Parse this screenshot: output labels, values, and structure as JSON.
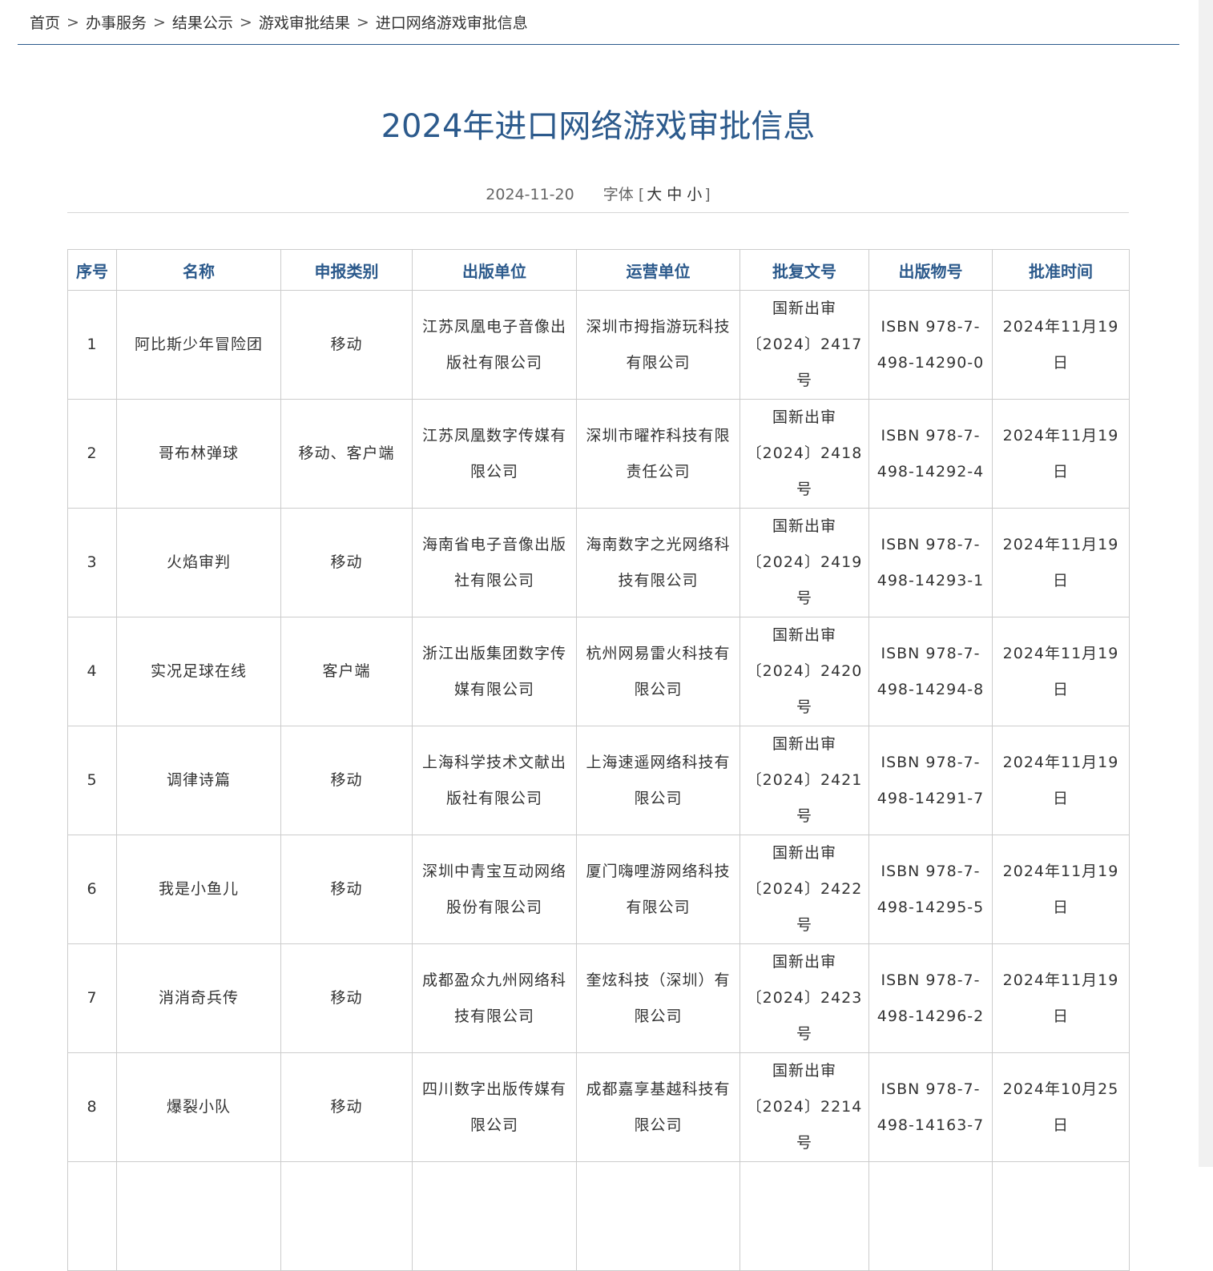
{
  "breadcrumb": {
    "separator": ">",
    "items": [
      "首页",
      "办事服务",
      "结果公示",
      "游戏审批结果",
      "进口网络游戏审批信息"
    ]
  },
  "article": {
    "title": "2024年进口网络游戏审批信息",
    "date": "2024-11-20",
    "font_size_label": "字体",
    "font_size_open": "[",
    "font_size_options": [
      "大",
      "中",
      "小"
    ],
    "font_size_close": "]"
  },
  "table": {
    "headers": [
      "序号",
      "名称",
      "申报类别",
      "出版单位",
      "运营单位",
      "批复文号",
      "出版物号",
      "批准时间"
    ],
    "rows": [
      [
        "1",
        "阿比斯少年冒险团",
        "移动",
        "江苏凤凰电子音像出版社有限公司",
        "深圳市拇指游玩科技有限公司",
        "国新出审〔2024〕2417号",
        "ISBN 978-7-498-14290-0",
        "2024年11月19日"
      ],
      [
        "2",
        "哥布林弹球",
        "移动、客户端",
        "江苏凤凰数字传媒有限公司",
        "深圳市曜祚科技有限责任公司",
        "国新出审〔2024〕2418号",
        "ISBN 978-7-498-14292-4",
        "2024年11月19日"
      ],
      [
        "3",
        "火焰审判",
        "移动",
        "海南省电子音像出版社有限公司",
        "海南数字之光网络科技有限公司",
        "国新出审〔2024〕2419号",
        "ISBN 978-7-498-14293-1",
        "2024年11月19日"
      ],
      [
        "4",
        "实况足球在线",
        "客户端",
        "浙江出版集团数字传媒有限公司",
        "杭州网易雷火科技有限公司",
        "国新出审〔2024〕2420号",
        "ISBN 978-7-498-14294-8",
        "2024年11月19日"
      ],
      [
        "5",
        "调律诗篇",
        "移动",
        "上海科学技术文献出版社有限公司",
        "上海速遥网络科技有限公司",
        "国新出审〔2024〕2421号",
        "ISBN 978-7-498-14291-7",
        "2024年11月19日"
      ],
      [
        "6",
        "我是小鱼儿",
        "移动",
        "深圳中青宝互动网络股份有限公司",
        "厦门嗨哩游网络科技有限公司",
        "国新出审〔2024〕2422号",
        "ISBN 978-7-498-14295-5",
        "2024年11月19日"
      ],
      [
        "7",
        "消消奇兵传",
        "移动",
        "成都盈众九州网络科技有限公司",
        "奎炫科技（深圳）有限公司",
        "国新出审〔2024〕2423号",
        "ISBN 978-7-498-14296-2",
        "2024年11月19日"
      ],
      [
        "8",
        "爆裂小队",
        "移动",
        "四川数字出版传媒有限公司",
        "成都嘉享基越科技有限公司",
        "国新出审〔2024〕2214号",
        "ISBN 978-7-498-14163-7",
        "2024年10月25日"
      ]
    ]
  },
  "colors": {
    "accent": "#2c5a8c",
    "border": "#cccccc",
    "text": "#333333"
  }
}
